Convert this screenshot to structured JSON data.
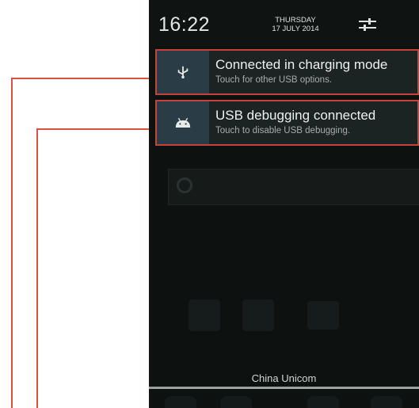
{
  "status_bar": {
    "time": "16:22",
    "day": "THURSDAY",
    "date": "17 JULY 2014",
    "settings_icon": "sliders-icon"
  },
  "notifications": [
    {
      "icon": "usb-icon",
      "title": "Connected in charging mode",
      "subtitle": "Touch for other USB options."
    },
    {
      "icon": "android-debug-icon",
      "title": "USB debugging connected",
      "subtitle": "Touch to disable USB debugging."
    }
  ],
  "carrier": "China Unicom",
  "colors": {
    "highlight_border": "#c8413a",
    "callout_line": "#d9533a",
    "icon_tile": "#2a3c45",
    "panel_bg": "#0d1110"
  }
}
